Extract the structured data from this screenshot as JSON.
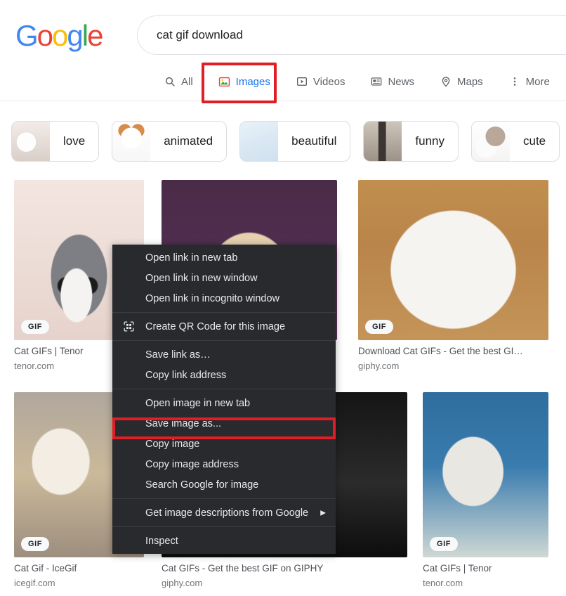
{
  "header": {
    "logo_letters": [
      "G",
      "o",
      "o",
      "g",
      "l",
      "e"
    ],
    "search": {
      "value": "cat gif download",
      "placeholder": "Search"
    }
  },
  "nav": {
    "tabs": [
      {
        "label": "All",
        "icon": "search-icon",
        "active": false
      },
      {
        "label": "Images",
        "icon": "image-icon",
        "active": true
      },
      {
        "label": "Videos",
        "icon": "video-icon",
        "active": false
      },
      {
        "label": "News",
        "icon": "news-icon",
        "active": false
      },
      {
        "label": "Maps",
        "icon": "map-pin-icon",
        "active": false
      },
      {
        "label": "More",
        "icon": "more-icon",
        "active": false
      }
    ],
    "highlight_color": "#e01e26",
    "active_color": "#1a73e8"
  },
  "chips": [
    {
      "label": "love",
      "thumb": "th-love"
    },
    {
      "label": "animated",
      "thumb": "th-animated"
    },
    {
      "label": "beautiful",
      "thumb": "th-beautiful"
    },
    {
      "label": "funny",
      "thumb": "th-funny"
    },
    {
      "label": "cute",
      "thumb": "th-cute"
    }
  ],
  "results": [
    {
      "title": "Cat GIFs | Tenor",
      "site": "tenor.com",
      "badge": "GIF",
      "img": "img-kitten1"
    },
    {
      "title": "",
      "site": "",
      "badge": "",
      "img": "img-kitten2"
    },
    {
      "title": "Download Cat GIFs - Get the best GI…",
      "site": "giphy.com",
      "badge": "GIF",
      "img": "img-kitten3"
    },
    {
      "title": "Cat Gif - IceGif",
      "site": "icegif.com",
      "badge": "GIF",
      "img": "img-kitten4"
    },
    {
      "title": "Cat GIFs - Get the best GIF on GIPHY",
      "site": "giphy.com",
      "badge": "",
      "img": "img-kitten5"
    },
    {
      "title": "Cat GIFs | Tenor",
      "site": "tenor.com",
      "badge": "GIF",
      "img": "img-kitten6"
    }
  ],
  "context_menu": {
    "groups": [
      {
        "items": [
          {
            "label": "Open link in new tab",
            "icon": null,
            "submenu": false
          },
          {
            "label": "Open link in new window",
            "icon": null,
            "submenu": false
          },
          {
            "label": "Open link in incognito window",
            "icon": null,
            "submenu": false
          }
        ]
      },
      {
        "items": [
          {
            "label": "Create QR Code for this image",
            "icon": "qr-code-icon",
            "submenu": false
          }
        ]
      },
      {
        "items": [
          {
            "label": "Save link as…",
            "icon": null,
            "submenu": false
          },
          {
            "label": "Copy link address",
            "icon": null,
            "submenu": false
          }
        ]
      },
      {
        "items": [
          {
            "label": "Open image in new tab",
            "icon": null,
            "submenu": false
          },
          {
            "label": "Save image as...",
            "icon": null,
            "submenu": false,
            "highlighted": true
          },
          {
            "label": "Copy image",
            "icon": null,
            "submenu": false
          },
          {
            "label": "Copy image address",
            "icon": null,
            "submenu": false
          },
          {
            "label": "Search Google for image",
            "icon": null,
            "submenu": false
          }
        ]
      },
      {
        "items": [
          {
            "label": "Get image descriptions from Google",
            "icon": null,
            "submenu": true
          }
        ]
      },
      {
        "items": [
          {
            "label": "Inspect",
            "icon": null,
            "submenu": false
          }
        ]
      }
    ],
    "background": "#292a2d",
    "text_color": "#e8eaed",
    "highlight_color": "#e01e26",
    "submenu_arrow": "▶"
  }
}
